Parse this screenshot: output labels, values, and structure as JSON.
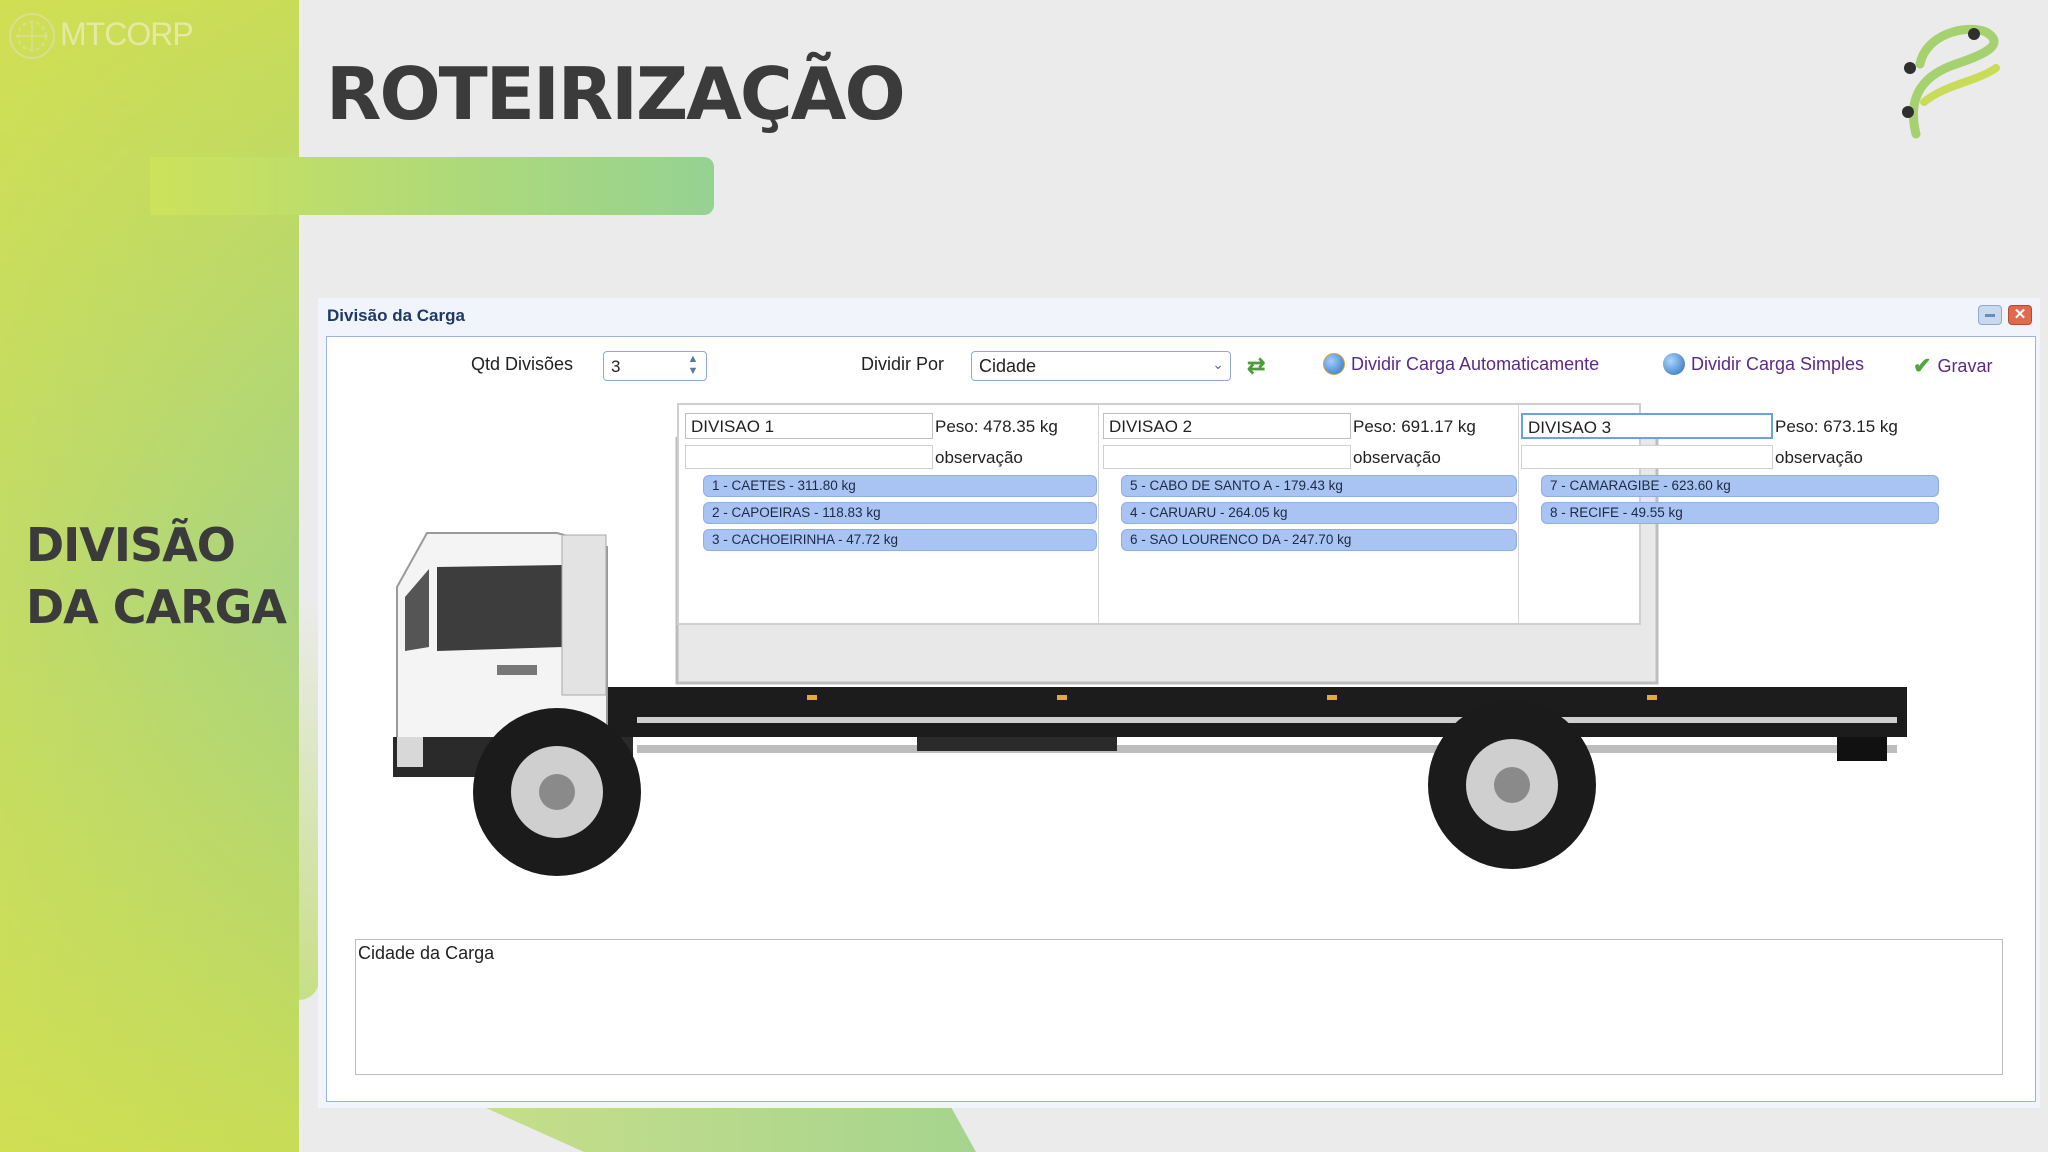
{
  "brand": {
    "logo_text": "MTCORP"
  },
  "slide": {
    "title": "ROTEIRIZAÇÃO",
    "side_title_line1": "DIVISÃO",
    "side_title_line2": "DA CARGA"
  },
  "window": {
    "title": "Divisão da Carga",
    "close_glyph": "✕"
  },
  "toolbar": {
    "qtd_label": "Qtd Divisões",
    "qtd_value": "3",
    "dividir_por_label": "Dividir Por",
    "dividir_por_value": "Cidade",
    "auto_label": "Dividir Carga Automaticamente",
    "simple_label": "Dividir Carga Simples",
    "save_label": "Gravar"
  },
  "divisions": [
    {
      "name": "DIVISAO 1",
      "peso": "Peso: 478.35 kg",
      "obs_label": "observação",
      "items": [
        "1 - CAETES - 311.80 kg",
        "2 - CAPOEIRAS - 118.83 kg",
        "3 - CACHOEIRINHA - 47.72 kg"
      ]
    },
    {
      "name": "DIVISAO 2",
      "peso": "Peso: 691.17 kg",
      "obs_label": "observação",
      "items": [
        "5 - CABO DE SANTO A - 179.43 kg",
        "4 - CARUARU - 264.05 kg",
        "6 - SAO LOURENCO DA - 247.70 kg"
      ]
    },
    {
      "name": "DIVISAO 3",
      "peso": "Peso: 673.15 kg",
      "obs_label": "observação",
      "items": [
        "7 - CAMARAGIBE - 623.60 kg",
        "8 - RECIFE - 49.55 kg"
      ]
    }
  ],
  "cidade": {
    "label": "Cidade da Carga"
  },
  "colors": {
    "accent_green": "#a9d481",
    "title_blue": "#1e3a66",
    "item_blue": "#a9c3f3",
    "link_purple": "#5b2a86"
  }
}
